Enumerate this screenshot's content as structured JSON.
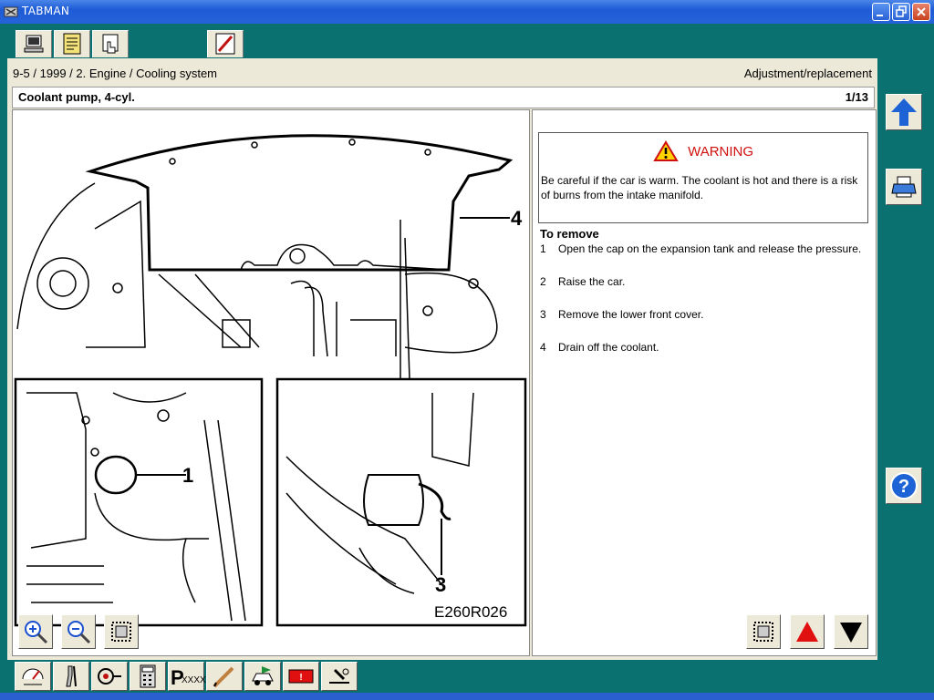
{
  "window": {
    "title": "TABMAN"
  },
  "breadcrumb": "9-5 / 1999 / 2. Engine / Cooling system",
  "mode": "Adjustment/replacement",
  "document": {
    "title": "Coolant pump, 4-cyl.",
    "page": "1/13"
  },
  "figure": {
    "callouts": [
      "1",
      "3",
      "4"
    ],
    "code": "E260R026"
  },
  "warning": {
    "label": "WARNING",
    "text": "Be careful if the car is warm. The coolant is hot and there is a risk of burns from the intake manifold."
  },
  "procedure": {
    "heading": "To remove",
    "steps": [
      {
        "n": "1",
        "text": "Open the cap on the expansion tank and release the pressure."
      },
      {
        "n": "2",
        "text": "Raise the car."
      },
      {
        "n": "3",
        "text": "Remove the lower front cover."
      },
      {
        "n": "4",
        "text": "Drain off the coolant."
      }
    ]
  },
  "bottom_toolbar": {
    "id_label": "XXXX"
  },
  "colors": {
    "teal": "#0b7070",
    "panel": "#ece9d8",
    "warning_red": "#d01010",
    "nav_blue": "#1e63d6",
    "nav_red": "#e01010"
  }
}
